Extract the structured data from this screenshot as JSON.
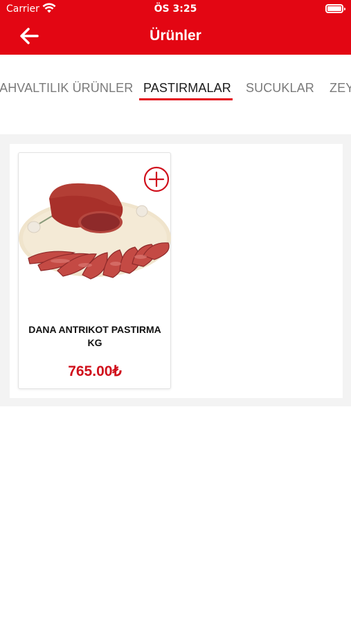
{
  "status_bar": {
    "carrier": "Carrier",
    "time": "ÖS 3:25",
    "wifi_icon": "wifi-icon",
    "battery_icon": "battery-icon"
  },
  "nav": {
    "title": "Ürünler",
    "back_icon": "arrow-left-icon"
  },
  "tabs": [
    {
      "label": "KAHVALTILIK ÜRÜNLER",
      "active": false
    },
    {
      "label": "PASTIRMALAR",
      "active": true
    },
    {
      "label": "SUCUKLAR",
      "active": false
    },
    {
      "label": "ZEY",
      "active": false
    }
  ],
  "products": [
    {
      "name": "DANA ANTRIKOT PASTIRMA KG",
      "price": "765.00₺",
      "add_icon": "plus-circle-icon",
      "image": "pastirma-product-photo"
    }
  ],
  "colors": {
    "brand_red": "#e30613",
    "price_red": "#d0101c",
    "tab_active": "#1a1a1a",
    "tab_inactive": "#7a7a7a"
  }
}
